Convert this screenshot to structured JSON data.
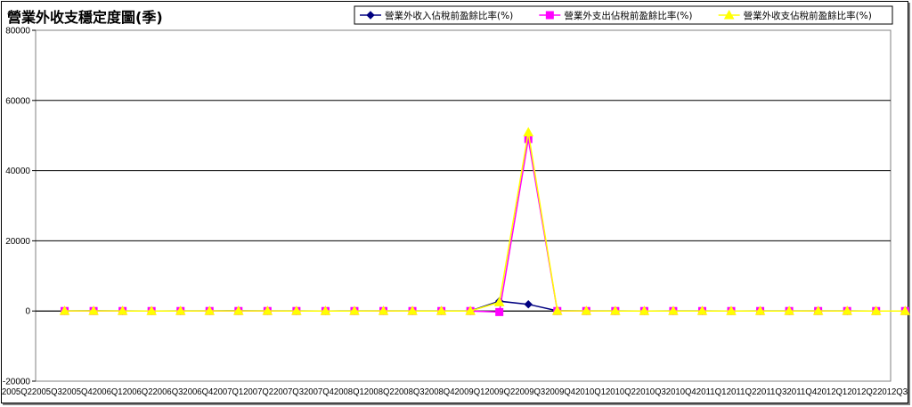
{
  "chart_data": {
    "type": "line",
    "title": "營業外收支穩定度圖(季)",
    "categories": [
      "2005Q2",
      "2005Q3",
      "2005Q4",
      "2006Q1",
      "2006Q2",
      "2006Q3",
      "2006Q4",
      "2007Q1",
      "2007Q2",
      "2007Q3",
      "2007Q4",
      "2008Q1",
      "2008Q2",
      "2008Q3",
      "2008Q4",
      "2009Q1",
      "2009Q2",
      "2009Q3",
      "2009Q4",
      "2010Q1",
      "2010Q2",
      "2010Q3",
      "2010Q4",
      "2011Q1",
      "2011Q2",
      "2011Q3",
      "2011Q4",
      "2012Q1",
      "2012Q2",
      "2012Q3"
    ],
    "ylim": [
      -20000,
      80000
    ],
    "yticks": [
      "80000",
      "60000",
      "40000",
      "20000",
      "0",
      "-20000"
    ],
    "grid": true,
    "legend_position": "top-right",
    "series": [
      {
        "name": "營業外收入佔稅前盈餘比率(%)",
        "color": "#000080",
        "marker": "diamond",
        "values": [
          30,
          40,
          20,
          10,
          20,
          30,
          40,
          30,
          20,
          10,
          20,
          30,
          20,
          20,
          20,
          2800,
          1900,
          40,
          30,
          20,
          10,
          20,
          20,
          10,
          20,
          20,
          30,
          20,
          10,
          10
        ]
      },
      {
        "name": "營業外支出佔稅前盈餘比率(%)",
        "color": "#ff00ff",
        "marker": "square",
        "values": [
          -10,
          -10,
          -10,
          -10,
          -10,
          -10,
          -10,
          -10,
          -10,
          -10,
          -10,
          -10,
          -10,
          -10,
          -10,
          -300,
          49000,
          -10,
          -10,
          -10,
          -10,
          -10,
          -10,
          -10,
          -10,
          -10,
          -10,
          -10,
          -10,
          -10
        ]
      },
      {
        "name": "營業外收支佔稅前盈餘比率(%)",
        "color": "#ffff00",
        "marker": "triangle",
        "values": [
          20,
          30,
          10,
          0,
          10,
          20,
          30,
          20,
          10,
          0,
          10,
          20,
          10,
          10,
          10,
          2500,
          50900,
          30,
          20,
          10,
          0,
          10,
          10,
          0,
          10,
          10,
          20,
          10,
          0,
          0
        ]
      }
    ]
  }
}
